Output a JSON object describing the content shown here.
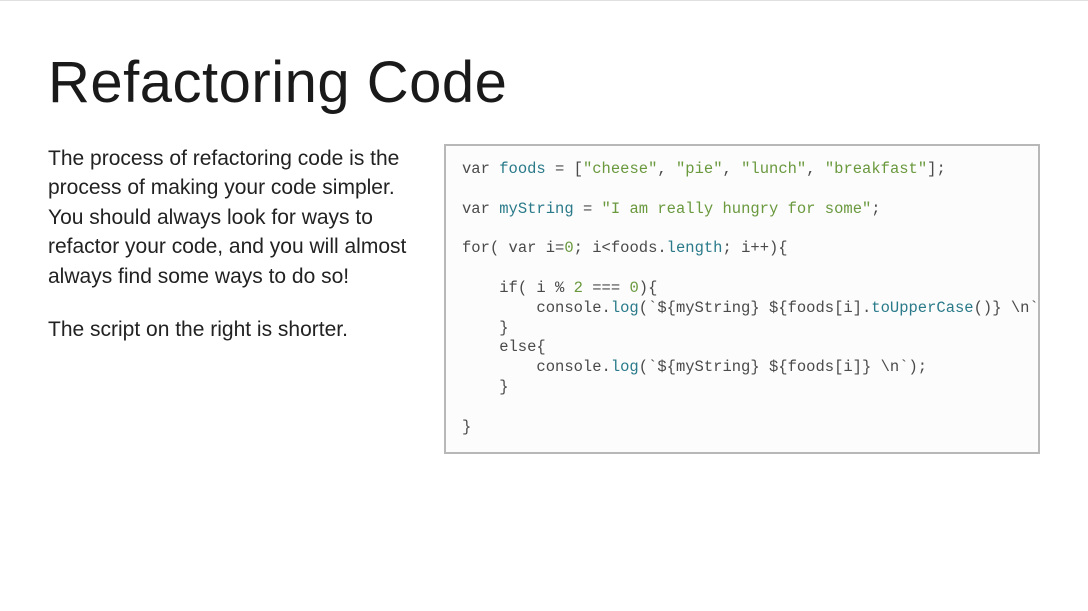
{
  "title": "Refactoring Code",
  "paragraphs": [
    "The process of refactoring code is the process of making your code simpler. You should always look for ways to refactor your code, and you will almost always find some ways to do so!",
    "The script on the right is shorter."
  ],
  "code": {
    "line1_var": "var",
    "line1_ident": "foods",
    "line1_eq": " = [",
    "line1_s1": "\"cheese\"",
    "line1_c1": ", ",
    "line1_s2": "\"pie\"",
    "line1_c2": ", ",
    "line1_s3": "\"lunch\"",
    "line1_c3": ", ",
    "line1_s4": "\"breakfast\"",
    "line1_end": "];",
    "line2_var": "var",
    "line2_ident": "myString",
    "line2_eq": " = ",
    "line2_str": "\"I am really hungry for some\"",
    "line2_end": ";",
    "line3_for": "for",
    "line3_open": "( ",
    "line3_var": "var",
    "line3_i": " i",
    "line3_eq": "=",
    "line3_zero": "0",
    "line3_semi": "; i<foods.",
    "line3_len": "length",
    "line3_inc": "; i++){",
    "line4_if": "    if",
    "line4_cond": "( i % ",
    "line4_two": "2",
    "line4_eqeq": " === ",
    "line4_zero": "0",
    "line4_close": "){",
    "line5_pre": "        console.",
    "line5_log": "log",
    "line5_open": "(",
    "line5_tpl": "`${myString} ${foods[i].",
    "line5_upper": "toUpperCase",
    "line5_rest": "()} \\n`",
    "line5_end": ");",
    "line6": "    }",
    "line7_else": "    else",
    "line7_brace": "{",
    "line8_pre": "        console.",
    "line8_log": "log",
    "line8_open": "(",
    "line8_tpl": "`${myString} ${foods[i]} \\n`",
    "line8_end": ");",
    "line9": "    }",
    "line10": "}"
  }
}
